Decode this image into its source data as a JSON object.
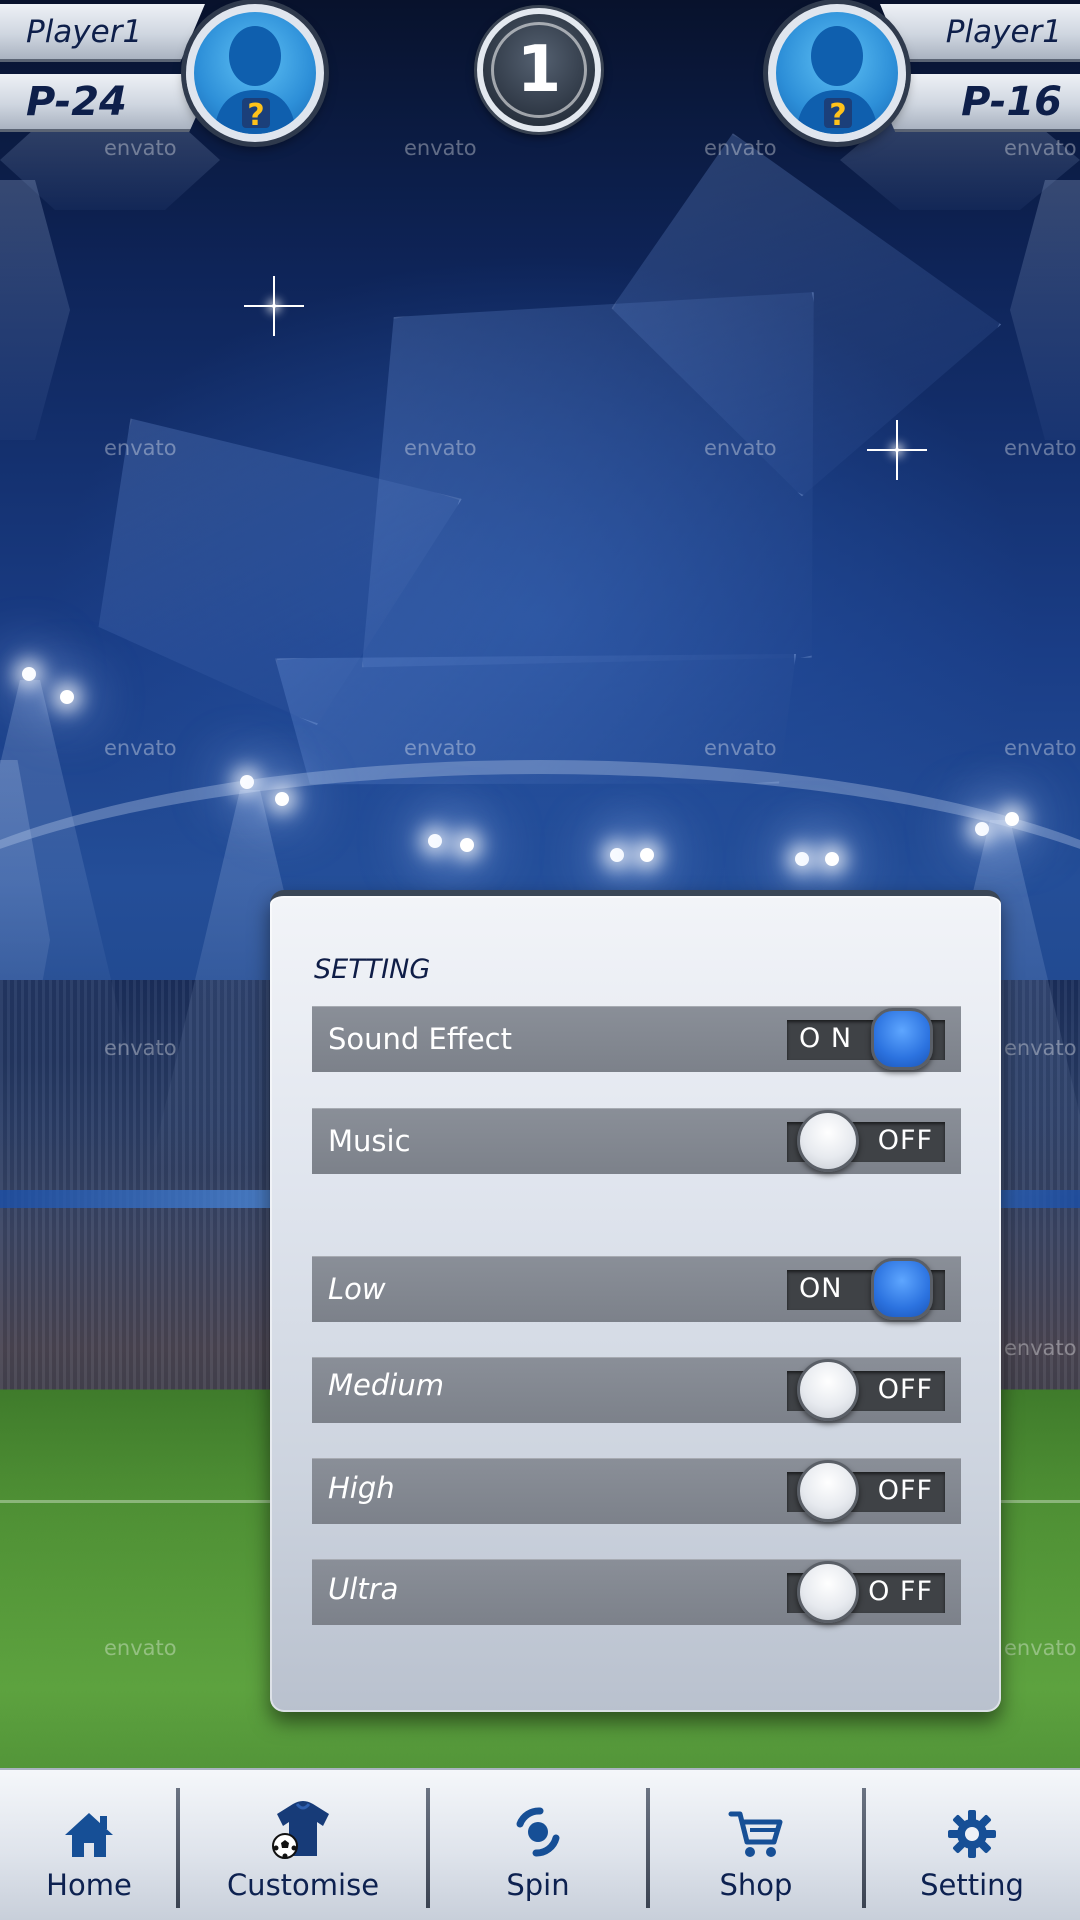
{
  "watermark_text": "envato",
  "hud": {
    "left_player": {
      "name": "Player1",
      "score": "P-24"
    },
    "right_player": {
      "name": "Player1",
      "score": "P-16"
    },
    "round_number": "1",
    "avatar_badge": "?"
  },
  "settings": {
    "title": "SETTING",
    "audio_rows": [
      {
        "label": "Sound Effect",
        "state": "on",
        "toggle_text": "O N"
      },
      {
        "label": "Music",
        "state": "off",
        "toggle_text": "OFF"
      }
    ],
    "quality_rows": [
      {
        "label": "Low",
        "state": "on",
        "toggle_text": "ON"
      },
      {
        "label": "Medium",
        "state": "off",
        "toggle_text": "OFF"
      },
      {
        "label": "High",
        "state": "off",
        "toggle_text": "OFF"
      },
      {
        "label": "Ultra",
        "state": "off",
        "toggle_text": "O FF"
      }
    ]
  },
  "nav": {
    "items": [
      {
        "label": "Home",
        "icon": "home-icon"
      },
      {
        "label": "Customise",
        "icon": "jersey-ball-icon"
      },
      {
        "label": "Spin",
        "icon": "spin-icon"
      },
      {
        "label": "Shop",
        "icon": "cart-icon"
      },
      {
        "label": "Setting",
        "icon": "gear-icon"
      }
    ]
  },
  "colors": {
    "toggle_on": "#2c73e0",
    "label_dark": "#0f1d47",
    "row_bg": "#7c818a"
  }
}
